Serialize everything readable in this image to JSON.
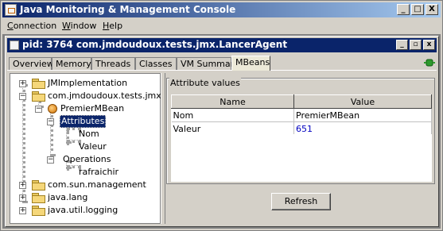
{
  "window": {
    "title": "Java Monitoring & Management Console",
    "buttons": {
      "minimize": "_",
      "maximize": "□",
      "close": "X"
    }
  },
  "menu": [
    {
      "mnemonic": "C",
      "rest": "onnection"
    },
    {
      "mnemonic": "W",
      "rest": "indow"
    },
    {
      "mnemonic": "H",
      "rest": "elp"
    }
  ],
  "connection": {
    "title": "pid: 3764 com.jmdoudoux.tests.jmx.LancerAgent",
    "buttons": {
      "minimize": "_",
      "restore": "▫",
      "close": "x"
    }
  },
  "tabs": [
    "Overview",
    "Memory",
    "Threads",
    "Classes",
    "VM Summary",
    "MBeans"
  ],
  "active_tab": "MBeans",
  "tree": {
    "n0": "JMImplementation",
    "n1": "com.jmdoudoux.tests.jmx",
    "n2": "PremierMBean",
    "n3": "Attributes",
    "n4": "Nom",
    "n5": "Valeur",
    "n6": "Operations",
    "n7": "rafraichir",
    "n8": "com.sun.management",
    "n9": "java.lang",
    "n10": "java.util.logging",
    "expander_expanded": "−",
    "expander_collapsed": "+"
  },
  "attributes": {
    "group_title": "Attribute values",
    "columns": [
      "Name",
      "Value"
    ],
    "rows": [
      {
        "name": "Nom",
        "value": "PremierMBean"
      },
      {
        "name": "Valeur",
        "value": "651"
      }
    ]
  },
  "refresh_label": "Refresh",
  "colors": {
    "title_active": "#0a246a",
    "selection": "#0a246a",
    "numeric_value": "#0000c0"
  }
}
